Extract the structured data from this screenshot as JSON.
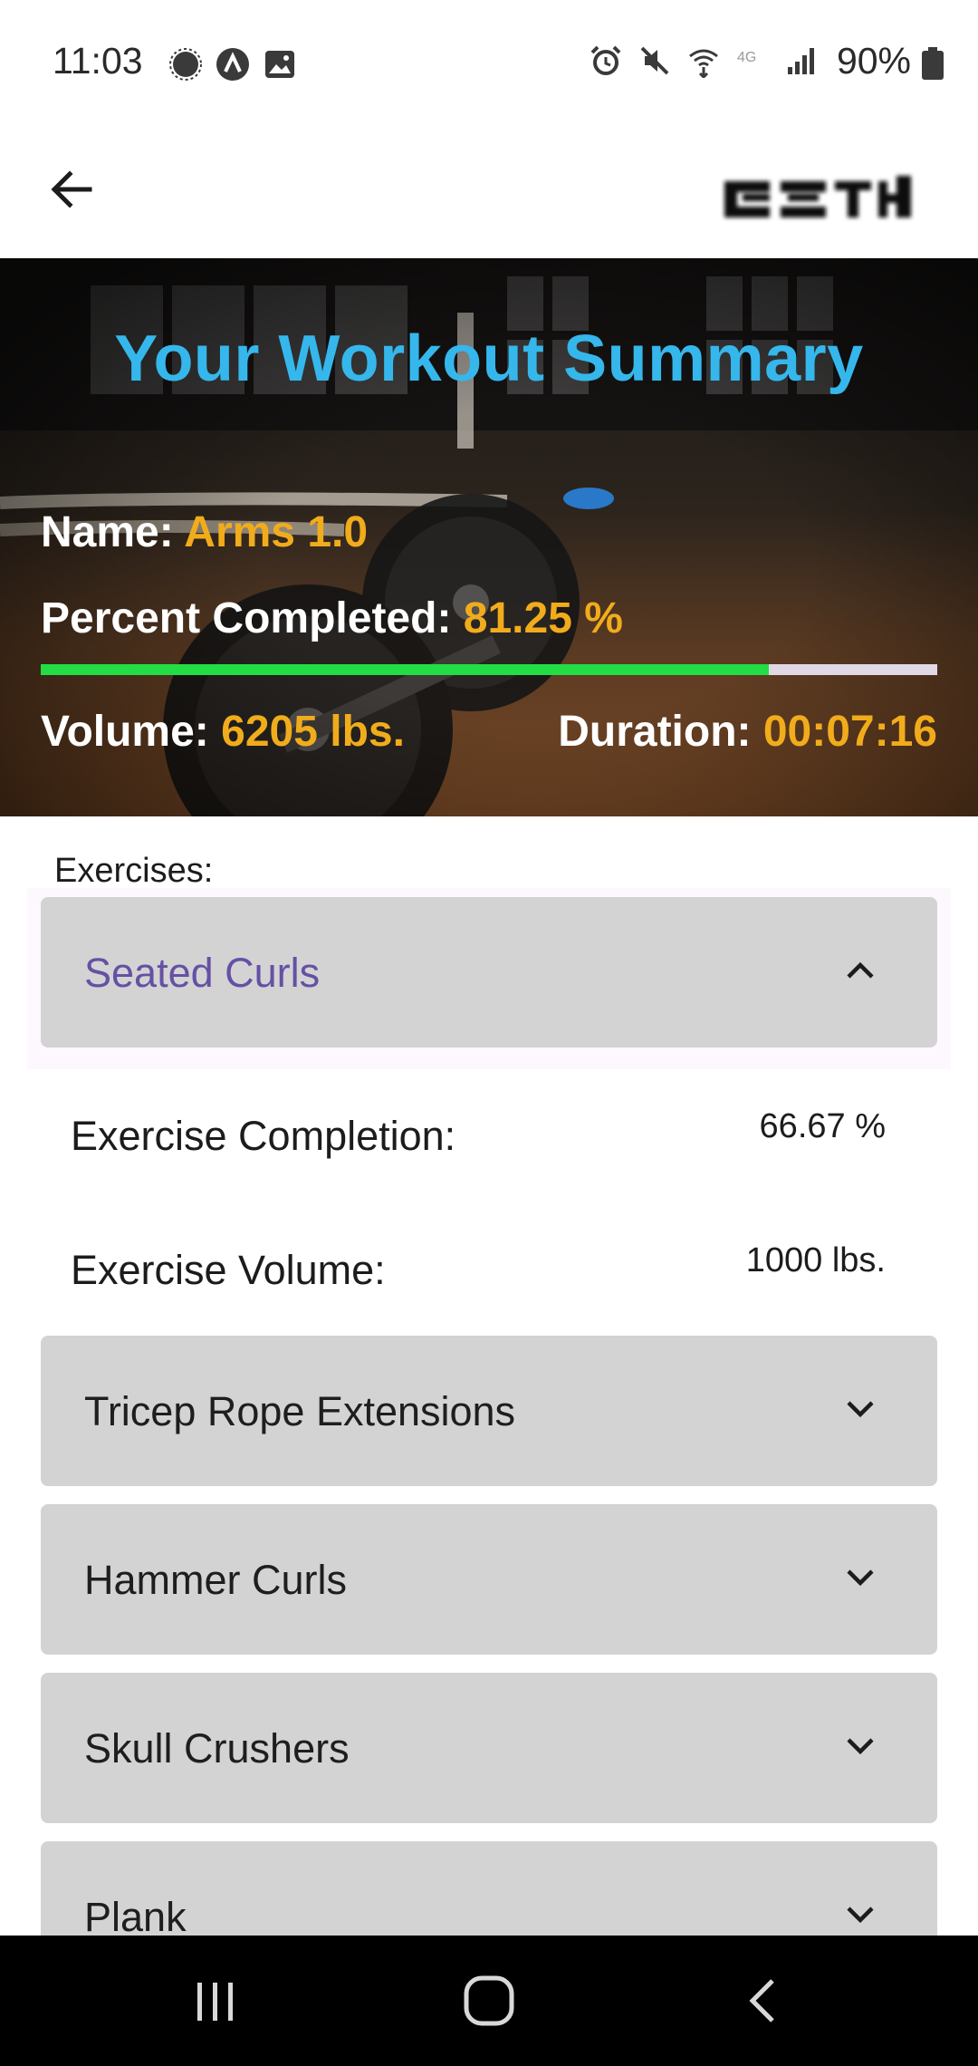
{
  "status_bar": {
    "time": "11:03",
    "battery_text": "90%",
    "left_icons": [
      "signal-messenger-icon",
      "app-notification-icon",
      "image-icon"
    ],
    "right_icons": [
      "alarm-icon",
      "mute-icon",
      "wifi-calling-icon",
      "4g-icon",
      "cellular-signal-icon",
      "battery-icon"
    ]
  },
  "app_bar": {
    "back_icon": "arrow-left-icon",
    "logo": "blurred-logo"
  },
  "summary": {
    "title": "Your Workout Summary",
    "name_label": "Name:",
    "name_value": "Arms 1.0",
    "percent_label": "Percent Completed:",
    "percent_value": "81.25 %",
    "progress_fraction": 0.8125,
    "volume_label": "Volume:",
    "volume_value": "6205 lbs.",
    "duration_label": "Duration:",
    "duration_value": "00:07:16"
  },
  "exercises": {
    "section_label": "Exercises:",
    "items": [
      {
        "name": "Seated Curls",
        "expanded": true,
        "chevron": "chevron-up-icon"
      },
      {
        "name": "Tricep Rope Extensions",
        "expanded": false,
        "chevron": "chevron-down-icon"
      },
      {
        "name": "Hammer Curls",
        "expanded": false,
        "chevron": "chevron-down-icon"
      },
      {
        "name": "Skull Crushers",
        "expanded": false,
        "chevron": "chevron-down-icon"
      },
      {
        "name": "Plank",
        "expanded": false,
        "chevron": "chevron-down-icon"
      }
    ],
    "detail": {
      "completion_label": "Exercise Completion:",
      "completion_value": "66.67 %",
      "volume_label": "Exercise Volume:",
      "volume_value": "1000 lbs."
    }
  },
  "colors": {
    "title_blue": "#35b7ec",
    "accent_orange": "#f1ac1c",
    "progress_green": "#22dd44",
    "progress_track": "#e1d8e6",
    "expanded_name_purple": "#6650a4",
    "card_gray": "#d3d3d3"
  },
  "nav_bar": {
    "recents_icon": "recents-icon",
    "home_icon": "home-icon",
    "back_icon": "nav-back-icon"
  }
}
